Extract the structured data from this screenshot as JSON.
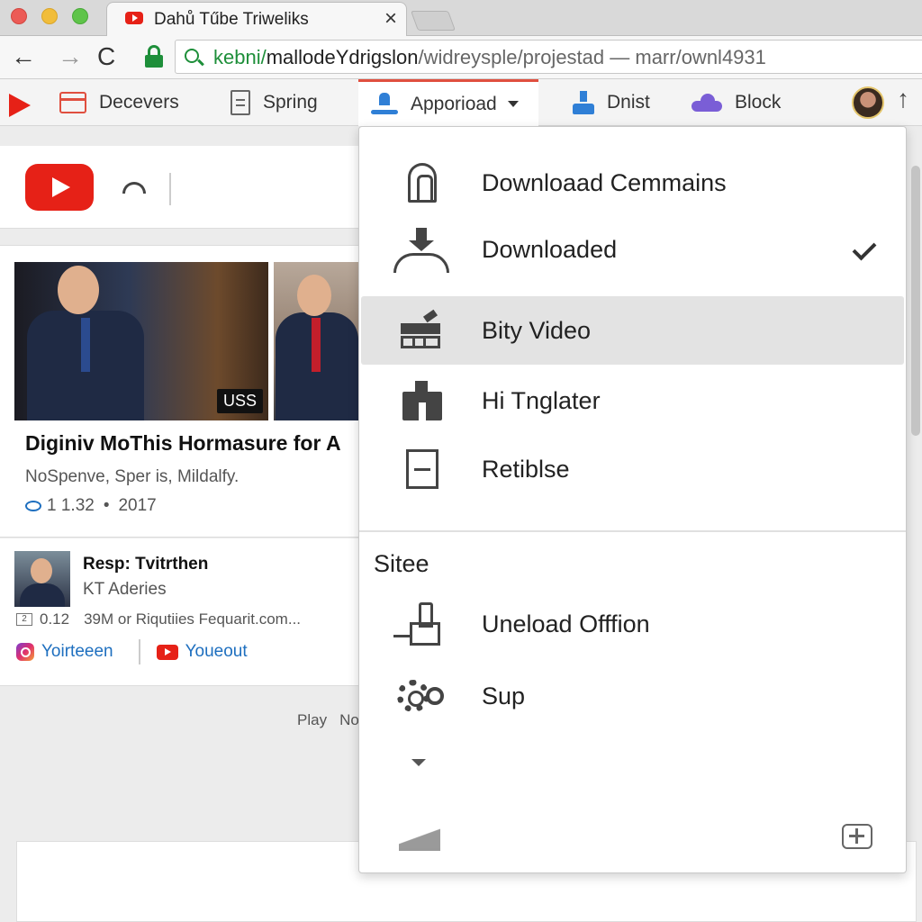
{
  "window": {
    "tab_title": "Dahů Tűbe Triweliks",
    "tab_close": "×"
  },
  "address_bar": {
    "back": "←",
    "forward": "→",
    "reload": "C",
    "url_host": "kebni/",
    "url_domain": "mallodeYdrigslon",
    "url_path": "/widreysple/projestad — marr/ownl4931"
  },
  "toolbar": {
    "items": [
      {
        "label": "Decevers",
        "icon": "calendar-icon"
      },
      {
        "label": "Spring",
        "icon": "document-icon"
      },
      {
        "label": "Apporioad",
        "icon": "download-icon",
        "active": true
      },
      {
        "label": "Dnist",
        "icon": "flask-icon"
      },
      {
        "label": "Block",
        "icon": "cloud-icon"
      }
    ],
    "up_arrow": "↑"
  },
  "feed": {
    "video1": {
      "badge": "USS",
      "title": "Diginiv MoThis Hormasure for A",
      "description": "NoSpenve, Sper is, Mildalfy.",
      "views": "1 1.32",
      "dot": "•",
      "year": "2017"
    },
    "video2": {
      "title": "Resp: Tvitrthen",
      "subtitle": "KT Aderies",
      "box_label": "2",
      "count": "0.12",
      "meta": "39M or Riqutiies Fequarit.com...",
      "link1": "Yoirteeen",
      "link2": "Youeout"
    },
    "play_row": [
      "Play",
      "No"
    ]
  },
  "menu": {
    "items": [
      {
        "label": "Downloaad Cemmains",
        "icon": "arch-icon"
      },
      {
        "label": "Downloaded",
        "icon": "download-arrow-icon",
        "checked": true
      },
      {
        "label": "Bity Video",
        "icon": "film-edit-icon",
        "highlighted": true
      },
      {
        "label": "Hi Tnglater",
        "icon": "block-icon"
      },
      {
        "label": "Retiblse",
        "icon": "box-icon"
      }
    ],
    "section_label": "Sitee",
    "section_items": [
      {
        "label": "Uneload Offfion",
        "icon": "upload-icon"
      },
      {
        "label": "Sup",
        "icon": "gear-icon"
      }
    ]
  },
  "colors": {
    "youtube_red": "#e62117",
    "secure_green": "#1e8f3a",
    "link_blue": "#1e6fbf",
    "menu_highlight": "#e3e3e3"
  }
}
